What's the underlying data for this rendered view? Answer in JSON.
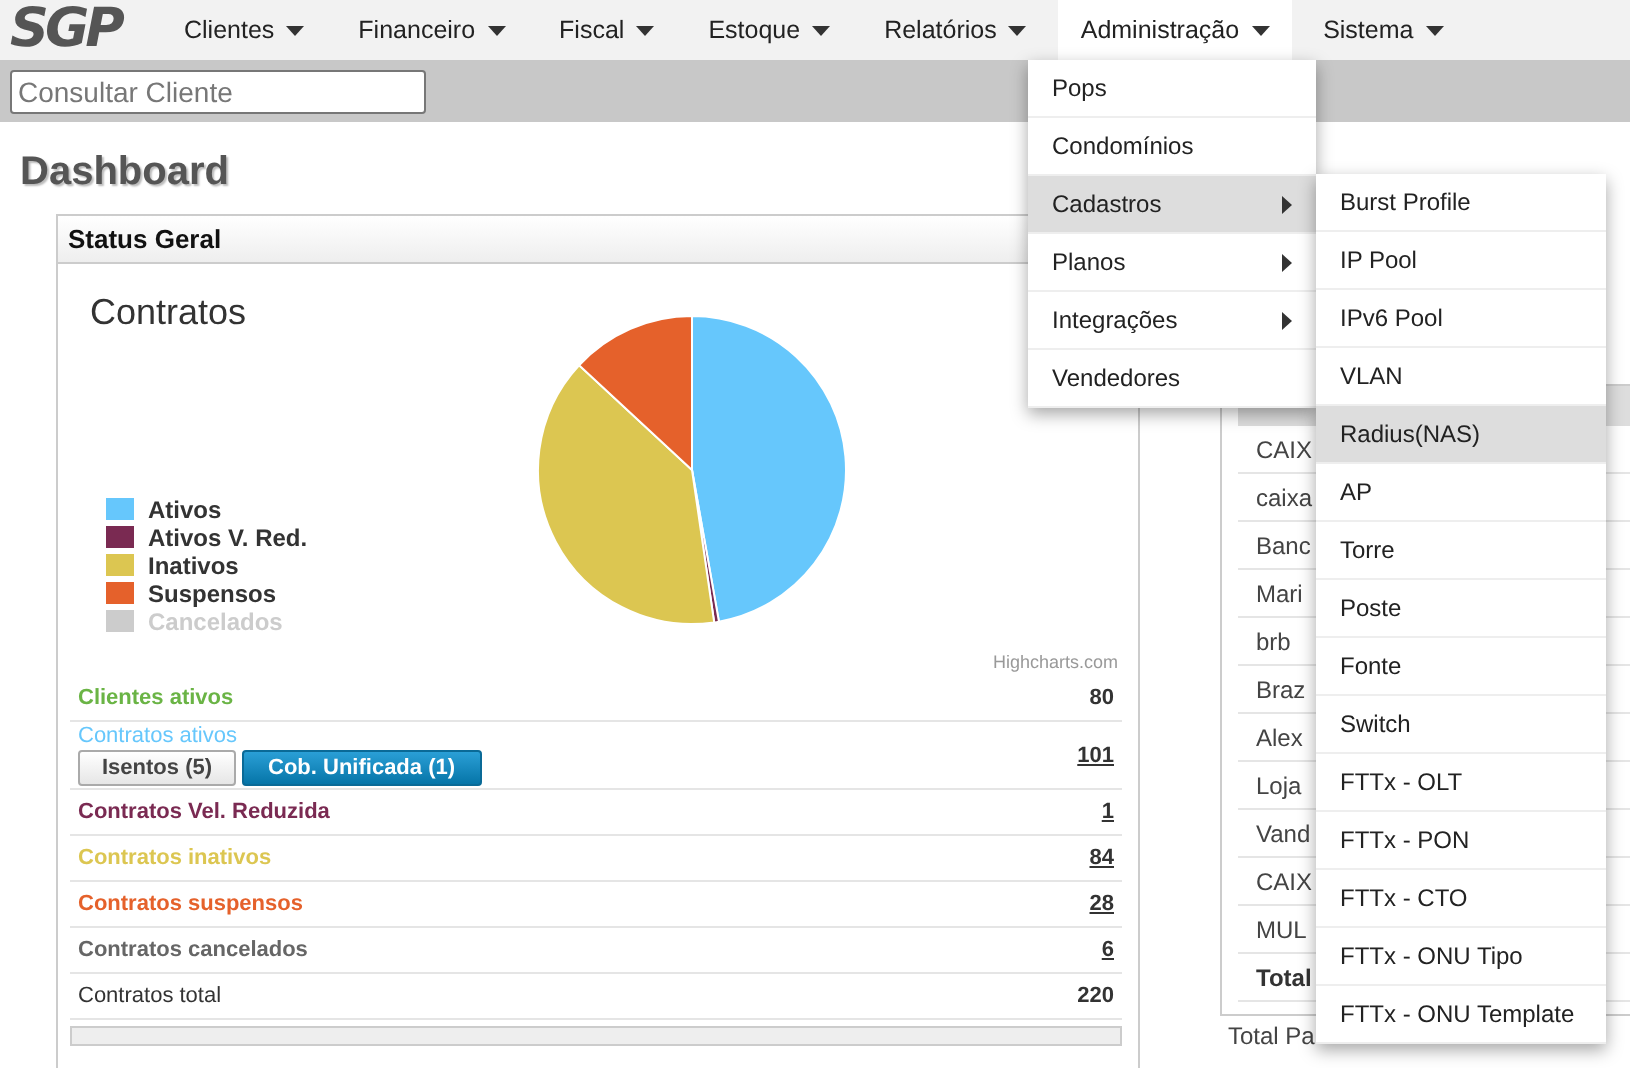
{
  "logo": "SGP",
  "nav": [
    {
      "label": "Clientes",
      "selected": false
    },
    {
      "label": "Financeiro",
      "selected": false
    },
    {
      "label": "Fiscal",
      "selected": false
    },
    {
      "label": "Estoque",
      "selected": false
    },
    {
      "label": "Relatórios",
      "selected": false
    },
    {
      "label": "Administração",
      "selected": true
    },
    {
      "label": "Sistema",
      "selected": false
    }
  ],
  "search": {
    "placeholder": "Consultar Cliente"
  },
  "page_title": "Dashboard",
  "status_panel": {
    "title": "Status Geral",
    "chart": {
      "title": "Contratos",
      "kind": "picture",
      "legend": [
        {
          "label": "Ativos",
          "color": "#66c7fc",
          "visible": true
        },
        {
          "label": "Ativos V. Red.",
          "color": "#7a2a52",
          "visible": true
        },
        {
          "label": "Inativos",
          "color": "#dcc651",
          "visible": true
        },
        {
          "label": "Suspensos",
          "color": "#e5612b",
          "visible": true
        },
        {
          "label": "Cancelados",
          "visible": false
        }
      ],
      "credit": "Highcharts.com"
    },
    "stats": [
      {
        "kind": "plain",
        "label": "Clientes ativos",
        "value": "80",
        "color": "#6ab445",
        "link": false,
        "bold": true
      },
      {
        "kind": "buttons",
        "label": "Contratos ativos",
        "value": "101",
        "color": "#66c7fc",
        "link": true,
        "bold": false,
        "buttons": [
          {
            "label": "Isentos (5)",
            "active": false
          },
          {
            "label": "Cob. Unificada (1)",
            "active": true
          }
        ]
      },
      {
        "kind": "plain",
        "label": "Contratos Vel. Reduzida",
        "value": "1",
        "color": "#7a2a52",
        "link": true,
        "bold": true
      },
      {
        "kind": "plain",
        "label": "Contratos inativos",
        "value": "84",
        "color": "#dcc651",
        "link": true,
        "bold": true
      },
      {
        "kind": "plain",
        "label": "Contratos suspensos",
        "value": "28",
        "color": "#e5612b",
        "link": true,
        "bold": true
      },
      {
        "kind": "plain",
        "label": "Contratos cancelados",
        "value": "6",
        "color": "#666666",
        "link": true,
        "bold": true
      },
      {
        "kind": "plain",
        "label": "Contratos total",
        "value": "220",
        "color": "#333333",
        "link": false,
        "bold": false
      }
    ]
  },
  "right_table": {
    "rows": [
      "CAIX",
      "caixa",
      "Banc",
      "Mari",
      "brb",
      "Braz",
      "Alex",
      "Loja",
      "Vand",
      "CAIX",
      "MUL",
      "Total"
    ],
    "footer_left": "Total Pa"
  },
  "menu": [
    {
      "label": "Pops",
      "submenu": false,
      "selected": false
    },
    {
      "label": "Condomínios",
      "submenu": false,
      "selected": false
    },
    {
      "label": "Cadastros",
      "submenu": true,
      "selected": true
    },
    {
      "label": "Planos",
      "submenu": true,
      "selected": false
    },
    {
      "label": "Integrações",
      "submenu": true,
      "selected": false
    },
    {
      "label": "Vendedores",
      "submenu": false,
      "selected": false
    }
  ],
  "submenu": [
    {
      "label": "Burst Profile",
      "selected": false
    },
    {
      "label": "IP Pool",
      "selected": false
    },
    {
      "label": "IPv6 Pool",
      "selected": false
    },
    {
      "label": "VLAN",
      "selected": false
    },
    {
      "label": "Radius(NAS)",
      "selected": true
    },
    {
      "label": "AP",
      "selected": false
    },
    {
      "label": "Torre",
      "selected": false
    },
    {
      "label": "Poste",
      "selected": false
    },
    {
      "label": "Fonte",
      "selected": false
    },
    {
      "label": "Switch",
      "selected": false
    },
    {
      "label": "FTTx - OLT",
      "selected": false
    },
    {
      "label": "FTTx - PON",
      "selected": false
    },
    {
      "label": "FTTx - CTO",
      "selected": false
    },
    {
      "label": "FTTx - ONU Tipo",
      "selected": false
    },
    {
      "label": "FTTx - ONU Template",
      "selected": false
    }
  ]
}
